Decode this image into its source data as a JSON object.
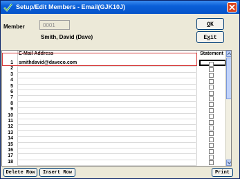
{
  "window": {
    "title": "Setup/Edit Members - Email(GJK10J)",
    "title_icon": "app-check-icon",
    "close_icon": "close-icon",
    "colors": {
      "titlebar": "#0a5fd8",
      "close": "#d9431e",
      "face": "#ece9d8",
      "selection_border": "#d63b3b"
    }
  },
  "member": {
    "label": "Member",
    "number": "0001",
    "name": "Smith, David (Dave)"
  },
  "buttons": {
    "ok": "OK",
    "exit": "Exit",
    "delete_row": "Delete Row",
    "insert_row": "Insert Row",
    "print": "Print"
  },
  "grid": {
    "columns": {
      "email": "E-Mail Address",
      "statement": "Statement"
    },
    "rows": [
      {
        "num": "1",
        "email": "smithdavid@daveco.com",
        "statement": false
      },
      {
        "num": "2",
        "email": "",
        "statement": false
      },
      {
        "num": "3",
        "email": "",
        "statement": false
      },
      {
        "num": "4",
        "email": "",
        "statement": false
      },
      {
        "num": "5",
        "email": "",
        "statement": false
      },
      {
        "num": "6",
        "email": "",
        "statement": false
      },
      {
        "num": "7",
        "email": "",
        "statement": false
      },
      {
        "num": "8",
        "email": "",
        "statement": false
      },
      {
        "num": "9",
        "email": "",
        "statement": false
      },
      {
        "num": "10",
        "email": "",
        "statement": false
      },
      {
        "num": "11",
        "email": "",
        "statement": false
      },
      {
        "num": "12",
        "email": "",
        "statement": false
      },
      {
        "num": "13",
        "email": "",
        "statement": false
      },
      {
        "num": "14",
        "email": "",
        "statement": false
      },
      {
        "num": "15",
        "email": "",
        "statement": false
      },
      {
        "num": "16",
        "email": "",
        "statement": false
      },
      {
        "num": "17",
        "email": "",
        "statement": false
      },
      {
        "num": "18",
        "email": "",
        "statement": false
      }
    ]
  }
}
